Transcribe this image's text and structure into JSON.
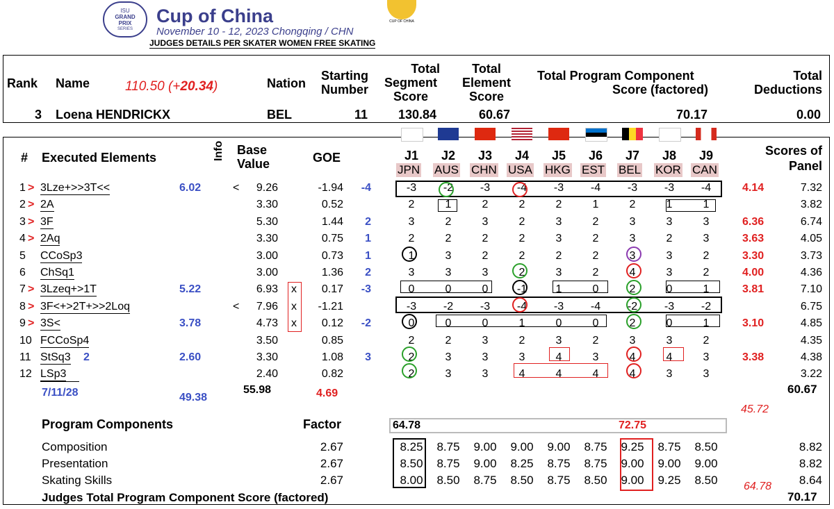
{
  "header": {
    "badge_lines": [
      "ISU",
      "GRAND",
      "PRIX",
      "SERIES"
    ],
    "event": "Cup of China",
    "dates": "November 10 - 12, 2023 Chongqing / CHN",
    "subtitle": "JUDGES DETAILS PER SKATER   WOMEN FREE SKATING",
    "logo_caption": "CUP OF CHINA"
  },
  "summary": {
    "labels": {
      "rank": "Rank",
      "name": "Name",
      "nation": "Nation",
      "starting_number": [
        "Starting",
        "Number"
      ],
      "tss": [
        "Total",
        "Segment",
        "Score"
      ],
      "tes": [
        "Total",
        "Element",
        "Score"
      ],
      "pcs": [
        "Total Program Component",
        "Score (factored)"
      ],
      "ded": [
        "Total",
        "Deductions"
      ]
    },
    "note_prefix": "110.50 (+",
    "note_bold": "20.34",
    "note_suffix": ")",
    "rank": "3",
    "name": "Loena HENDRICKX",
    "nation": "BEL",
    "starting_number": "11",
    "tss": "130.84",
    "tes": "60.67",
    "pcs": "70.17",
    "ded": "0.00"
  },
  "elements_header": {
    "num": "#",
    "executed": "Executed Elements",
    "info": "Info",
    "base": [
      "Base",
      "Value"
    ],
    "goe": "GOE",
    "scores": [
      "Scores of",
      "Panel"
    ]
  },
  "judges": [
    {
      "j": "J1",
      "c": "JPN",
      "flag": "jpn"
    },
    {
      "j": "J2",
      "c": "AUS",
      "flag": "aus"
    },
    {
      "j": "J3",
      "c": "CHN",
      "flag": "chn"
    },
    {
      "j": "J4",
      "c": "USA",
      "flag": "usa"
    },
    {
      "j": "J5",
      "c": "HKG",
      "flag": "hkg"
    },
    {
      "j": "J6",
      "c": "EST",
      "flag": "est"
    },
    {
      "j": "J7",
      "c": "BEL",
      "flag": "bel"
    },
    {
      "j": "J8",
      "c": "KOR",
      "flag": "kor"
    },
    {
      "j": "J9",
      "c": "CAN",
      "flag": "can"
    }
  ],
  "elements": [
    {
      "n": "1",
      "arrow": ">",
      "name": "3Lze+>>3T<<",
      "blue": "6.02",
      "info": "<",
      "base": "9.26",
      "goe": "-1.94",
      "goe_note": "-4",
      "j": [
        "-3",
        "-2",
        "-3",
        "-4",
        "-3",
        "-4",
        "-3",
        "-3",
        "-4"
      ],
      "red": "4.14",
      "panel": "7.32"
    },
    {
      "n": "2",
      "arrow": ">",
      "name": "2A",
      "blue": "",
      "info": "",
      "base": "3.30",
      "goe": "0.52",
      "goe_note": "",
      "j": [
        "2",
        "1",
        "2",
        "2",
        "2",
        "1",
        "2",
        "1",
        "1"
      ],
      "red": "",
      "panel": "3.82"
    },
    {
      "n": "3",
      "arrow": ">",
      "name": "3F",
      "blue": "",
      "info": "",
      "base": "5.30",
      "goe": "1.44",
      "goe_note": "2",
      "j": [
        "3",
        "2",
        "3",
        "2",
        "3",
        "2",
        "3",
        "3",
        "3"
      ],
      "red": "6.36",
      "panel": "6.74"
    },
    {
      "n": "4",
      "arrow": ">",
      "name": "2Aq",
      "blue": "",
      "info": "",
      "base": "3.30",
      "goe": "0.75",
      "goe_note": "1",
      "j": [
        "2",
        "2",
        "2",
        "2",
        "3",
        "2",
        "3",
        "2",
        "3"
      ],
      "red": "3.63",
      "panel": "4.05"
    },
    {
      "n": "5",
      "arrow": "",
      "name": "CCoSp3",
      "blue": "",
      "info": "",
      "base": "3.00",
      "goe": "0.73",
      "goe_note": "1",
      "j": [
        "1",
        "3",
        "2",
        "2",
        "2",
        "2",
        "3",
        "3",
        "2"
      ],
      "red": "3.30",
      "panel": "3.73"
    },
    {
      "n": "6",
      "arrow": "",
      "name": "ChSq1",
      "blue": "",
      "info": "",
      "base": "3.00",
      "goe": "1.36",
      "goe_note": "2",
      "j": [
        "3",
        "3",
        "3",
        "2",
        "3",
        "2",
        "4",
        "3",
        "2"
      ],
      "red": "4.00",
      "panel": "4.36"
    },
    {
      "n": "7",
      "arrow": ">",
      "name": "3Lzeq+>1T",
      "blue": "5.22",
      "info": "",
      "base": "6.93",
      "x": "x",
      "goe": "0.17",
      "goe_note": "-3",
      "j": [
        "0",
        "0",
        "0",
        "-1",
        "1",
        "0",
        "2",
        "0",
        "1"
      ],
      "red": "3.81",
      "panel": "7.10"
    },
    {
      "n": "8",
      "arrow": ">",
      "name": "3F<+>2T+>>2Loq",
      "blue": "",
      "info": "<",
      "base": "7.96",
      "x": "x",
      "goe": "-1.21",
      "goe_note": "",
      "j": [
        "-3",
        "-2",
        "-3",
        "-4",
        "-3",
        "-4",
        "-2",
        "-3",
        "-2"
      ],
      "red": "",
      "panel": "6.75"
    },
    {
      "n": "9",
      "arrow": ">",
      "name": "3S<",
      "blue": "3.78",
      "info": "",
      "base": "4.73",
      "x": "x",
      "goe": "0.12",
      "goe_note": "-2",
      "j": [
        "0",
        "0",
        "0",
        "1",
        "0",
        "0",
        "2",
        "0",
        "1"
      ],
      "red": "3.10",
      "panel": "4.85"
    },
    {
      "n": "10",
      "arrow": "",
      "name": "FCCoSp4",
      "blue": "",
      "info": "",
      "base": "3.50",
      "goe": "0.85",
      "goe_note": "",
      "j": [
        "2",
        "2",
        "3",
        "2",
        "3",
        "2",
        "3",
        "3",
        "2"
      ],
      "red": "",
      "panel": "4.35"
    },
    {
      "n": "11",
      "arrow": "",
      "name": "StSq3",
      "name_blue": "2",
      "blue": "2.60",
      "info": "",
      "base": "3.30",
      "goe": "1.08",
      "goe_note": "3",
      "j": [
        "2",
        "3",
        "3",
        "3",
        "4",
        "3",
        "4",
        "4",
        "3"
      ],
      "red": "3.38",
      "panel": "4.38"
    },
    {
      "n": "12",
      "arrow": "",
      "name": "LSp3",
      "blue": "",
      "info": "",
      "base": "2.40",
      "goe": "0.82",
      "goe_note": "",
      "j": [
        "2",
        "3",
        "3",
        "4",
        "4",
        "4",
        "4",
        "3",
        "3"
      ],
      "red": "",
      "panel": "3.22"
    }
  ],
  "element_totals": {
    "count_note": "7/11/28",
    "blue_total": "49.38",
    "base": "55.98",
    "goe": "4.69",
    "tes": "60.67",
    "red_note": "45.72"
  },
  "components": {
    "title": "Program Components",
    "factor_label": "Factor",
    "box_left": "64.78",
    "box_right": "72.75",
    "rows": [
      {
        "name": "Composition",
        "factor": "2.67",
        "j": [
          "8.25",
          "8.75",
          "9.00",
          "9.00",
          "9.00",
          "8.75",
          "9.25",
          "8.75",
          "8.50"
        ],
        "panel": "8.82"
      },
      {
        "name": "Presentation",
        "factor": "2.67",
        "j": [
          "8.50",
          "8.75",
          "9.00",
          "8.25",
          "8.75",
          "8.75",
          "9.00",
          "9.00",
          "9.00"
        ],
        "panel": "8.82"
      },
      {
        "name": "Skating Skills",
        "factor": "2.67",
        "j": [
          "8.00",
          "8.50",
          "8.75",
          "8.50",
          "8.75",
          "8.50",
          "9.00",
          "9.25",
          "8.50"
        ],
        "panel": "8.64"
      }
    ],
    "total_label": "Judges Total Program Component Score (factored)",
    "red_note": "64.78",
    "total": "70.17"
  }
}
